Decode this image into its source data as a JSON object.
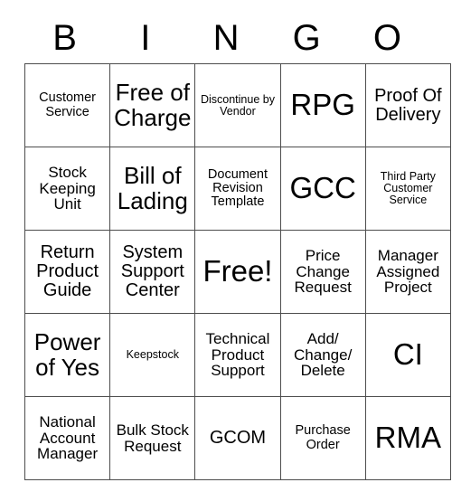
{
  "card": {
    "header_letters": [
      "B",
      "I",
      "N",
      "G",
      "O"
    ],
    "colors": {
      "background": "#ffffff",
      "text": "#000000",
      "grid_line": "#4d4d4d"
    },
    "rows": [
      [
        {
          "text": "Customer Service",
          "size": "sm"
        },
        {
          "text": "Free of Charge",
          "size": "xl"
        },
        {
          "text": "Discontinue by Vendor",
          "size": "xs"
        },
        {
          "text": "RPG",
          "size": "xxl"
        },
        {
          "text": "Proof Of Delivery",
          "size": "lg"
        }
      ],
      [
        {
          "text": "Stock Keeping Unit",
          "size": "md"
        },
        {
          "text": "Bill of Lading",
          "size": "xl"
        },
        {
          "text": "Document Revision Template",
          "size": "sm"
        },
        {
          "text": "GCC",
          "size": "xxl"
        },
        {
          "text": "Third Party Customer Service",
          "size": "xs"
        }
      ],
      [
        {
          "text": "Return Product Guide",
          "size": "lg"
        },
        {
          "text": "System Support Center",
          "size": "lg"
        },
        {
          "text": "Free!",
          "size": "xxl"
        },
        {
          "text": "Price Change Request",
          "size": "md"
        },
        {
          "text": "Manager Assigned Project",
          "size": "md"
        }
      ],
      [
        {
          "text": "Power of Yes",
          "size": "xl"
        },
        {
          "text": "Keepstock",
          "size": "xs"
        },
        {
          "text": "Technical Product Support",
          "size": "md"
        },
        {
          "text": "Add/ Change/ Delete",
          "size": "md"
        },
        {
          "text": "CI",
          "size": "xxl"
        }
      ],
      [
        {
          "text": "National Account Manager",
          "size": "md"
        },
        {
          "text": "Bulk Stock Request",
          "size": "md"
        },
        {
          "text": "GCOM",
          "size": "lg"
        },
        {
          "text": "Purchase Order",
          "size": "sm"
        },
        {
          "text": "RMA",
          "size": "xxl"
        }
      ]
    ]
  }
}
